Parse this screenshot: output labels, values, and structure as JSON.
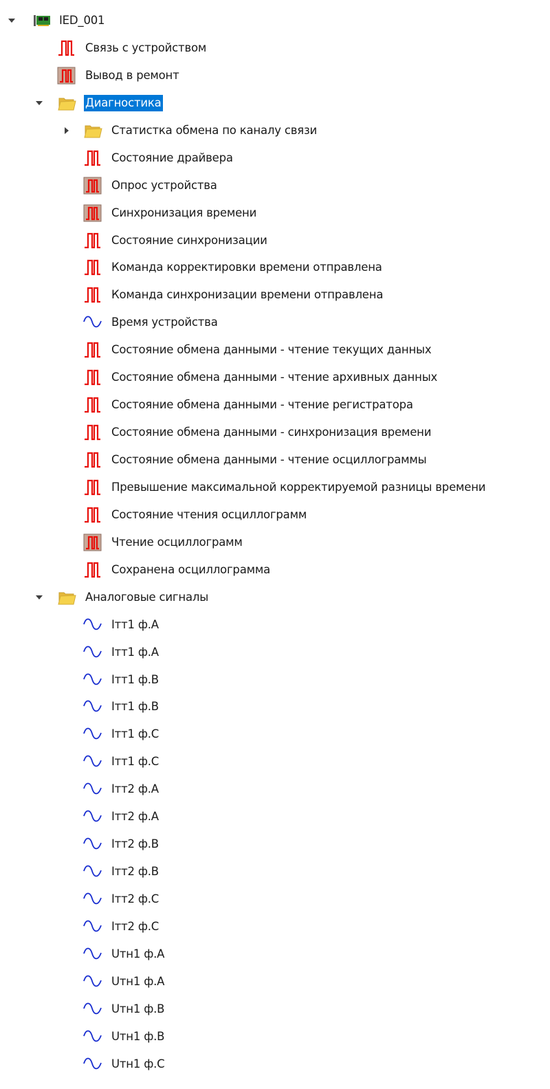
{
  "tree": [
    {
      "level": 0,
      "expander": "expanded",
      "icon": "device-icon",
      "label": "IED_001"
    },
    {
      "level": 1,
      "expander": "none",
      "icon": "discrete-signal-icon",
      "label": "Связь с устройством"
    },
    {
      "level": 1,
      "expander": "none",
      "icon": "discrete-command-icon",
      "label": "Вывод в ремонт"
    },
    {
      "level": 1,
      "expander": "expanded",
      "icon": "folder-icon",
      "label": "Диагностика",
      "selected": true
    },
    {
      "level": 2,
      "expander": "collapsed",
      "icon": "folder-icon",
      "label": "Статистка обмена по каналу связи"
    },
    {
      "level": 2,
      "expander": "none",
      "icon": "discrete-signal-icon",
      "label": "Состояние драйвера"
    },
    {
      "level": 2,
      "expander": "none",
      "icon": "discrete-command-icon",
      "label": "Опрос устройства"
    },
    {
      "level": 2,
      "expander": "none",
      "icon": "discrete-command-icon",
      "label": "Синхронизация времени"
    },
    {
      "level": 2,
      "expander": "none",
      "icon": "discrete-signal-icon",
      "label": "Состояние синхронизации"
    },
    {
      "level": 2,
      "expander": "none",
      "icon": "discrete-signal-icon",
      "label": "Команда корректировки времени отправлена"
    },
    {
      "level": 2,
      "expander": "none",
      "icon": "discrete-signal-icon",
      "label": "Команда синхронизации времени отправлена"
    },
    {
      "level": 2,
      "expander": "none",
      "icon": "analog-signal-icon",
      "label": "Время устройства"
    },
    {
      "level": 2,
      "expander": "none",
      "icon": "discrete-signal-icon",
      "label": "Состояние обмена данными - чтение текущих данных"
    },
    {
      "level": 2,
      "expander": "none",
      "icon": "discrete-signal-icon",
      "label": "Состояние обмена данными - чтение архивных данных"
    },
    {
      "level": 2,
      "expander": "none",
      "icon": "discrete-signal-icon",
      "label": "Состояние обмена данными - чтение регистратора"
    },
    {
      "level": 2,
      "expander": "none",
      "icon": "discrete-signal-icon",
      "label": "Состояние обмена данными - синхронизация времени"
    },
    {
      "level": 2,
      "expander": "none",
      "icon": "discrete-signal-icon",
      "label": "Состояние обмена данными - чтение осциллограммы"
    },
    {
      "level": 2,
      "expander": "none",
      "icon": "discrete-signal-icon",
      "label": "Превышение максимальной корректируемой разницы времени"
    },
    {
      "level": 2,
      "expander": "none",
      "icon": "discrete-signal-icon",
      "label": "Состояние чтения осциллограмм"
    },
    {
      "level": 2,
      "expander": "none",
      "icon": "discrete-command-icon",
      "label": "Чтение осциллограмм"
    },
    {
      "level": 2,
      "expander": "none",
      "icon": "discrete-signal-icon",
      "label": "Сохранена осциллограмма"
    },
    {
      "level": 1,
      "expander": "expanded",
      "icon": "folder-icon",
      "label": "Аналоговые сигналы"
    },
    {
      "level": 2,
      "expander": "none",
      "icon": "analog-signal-icon",
      "label": "Iтт1 ф.A"
    },
    {
      "level": 2,
      "expander": "none",
      "icon": "analog-signal-icon",
      "label": "Iтт1 ф.A"
    },
    {
      "level": 2,
      "expander": "none",
      "icon": "analog-signal-icon",
      "label": "Iтт1 ф.B"
    },
    {
      "level": 2,
      "expander": "none",
      "icon": "analog-signal-icon",
      "label": "Iтт1 ф.B"
    },
    {
      "level": 2,
      "expander": "none",
      "icon": "analog-signal-icon",
      "label": "Iтт1 ф.C"
    },
    {
      "level": 2,
      "expander": "none",
      "icon": "analog-signal-icon",
      "label": "Iтт1 ф.C"
    },
    {
      "level": 2,
      "expander": "none",
      "icon": "analog-signal-icon",
      "label": "Iтт2 ф.A"
    },
    {
      "level": 2,
      "expander": "none",
      "icon": "analog-signal-icon",
      "label": "Iтт2 ф.A"
    },
    {
      "level": 2,
      "expander": "none",
      "icon": "analog-signal-icon",
      "label": "Iтт2 ф.B"
    },
    {
      "level": 2,
      "expander": "none",
      "icon": "analog-signal-icon",
      "label": "Iтт2 ф.B"
    },
    {
      "level": 2,
      "expander": "none",
      "icon": "analog-signal-icon",
      "label": "Iтт2 ф.C"
    },
    {
      "level": 2,
      "expander": "none",
      "icon": "analog-signal-icon",
      "label": "Iтт2 ф.C"
    },
    {
      "level": 2,
      "expander": "none",
      "icon": "analog-signal-icon",
      "label": "Uтн1 ф.A"
    },
    {
      "level": 2,
      "expander": "none",
      "icon": "analog-signal-icon",
      "label": "Uтн1 ф.A"
    },
    {
      "level": 2,
      "expander": "none",
      "icon": "analog-signal-icon",
      "label": "Uтн1 ф.B"
    },
    {
      "level": 2,
      "expander": "none",
      "icon": "analog-signal-icon",
      "label": "Uтн1 ф.B"
    },
    {
      "level": 2,
      "expander": "none",
      "icon": "analog-signal-icon",
      "label": "Uтн1 ф.C"
    }
  ],
  "colors": {
    "selection": "#0078d7",
    "selection_text": "#ffffff",
    "text": "#1a1a1a",
    "discrete_signal": "#e8100a",
    "analog_signal": "#1a2fd0",
    "command_bg": "#c8a898",
    "folder": "#f5d24c",
    "device_board": "#2e8b2e",
    "expander": "#404040"
  }
}
